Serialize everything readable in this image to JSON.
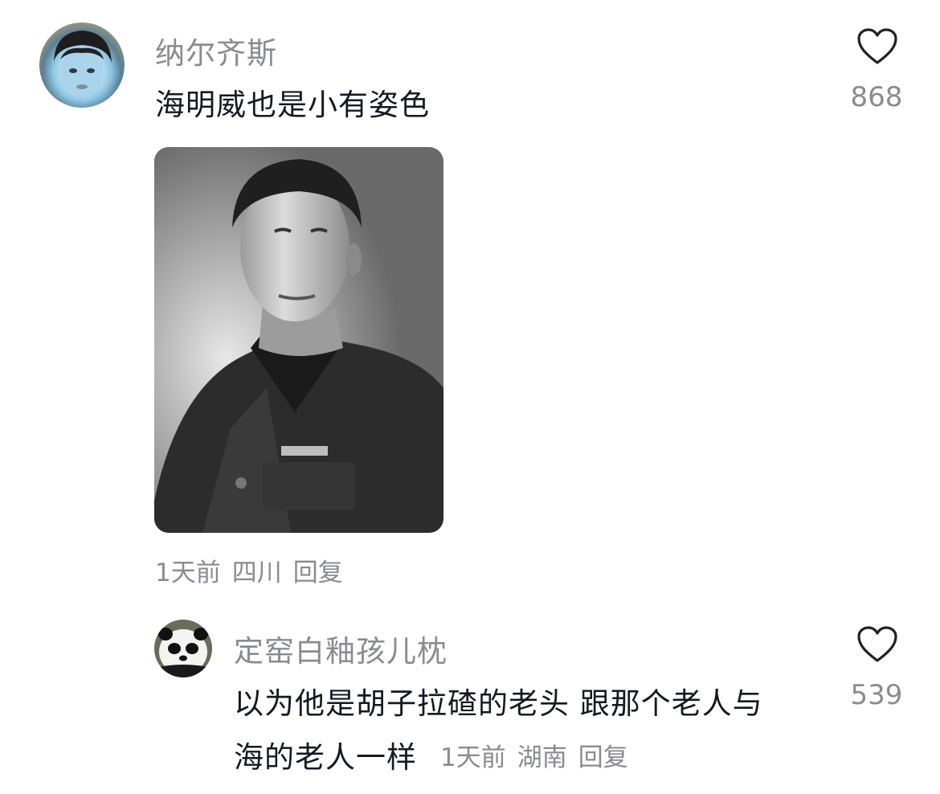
{
  "comments": [
    {
      "username": "纳尔齐斯",
      "text": "海明威也是小有姿色",
      "likes": "868",
      "meta": {
        "time": "1天前",
        "location": "四川",
        "reply": "回复"
      },
      "has_image": true
    },
    {
      "username": "定窑白釉孩儿枕",
      "text_line1": "以为他是胡子拉碴的老头 跟那个老人与",
      "text_line2": "海的老人一样",
      "likes": "539",
      "meta": {
        "time": "1天前",
        "location": "湖南",
        "reply": "回复"
      }
    }
  ],
  "colors": {
    "primary_text": "#161823",
    "secondary_text": "#8a8b91",
    "icon": "#222222"
  },
  "icons": {
    "like": "heart-outline-icon"
  }
}
